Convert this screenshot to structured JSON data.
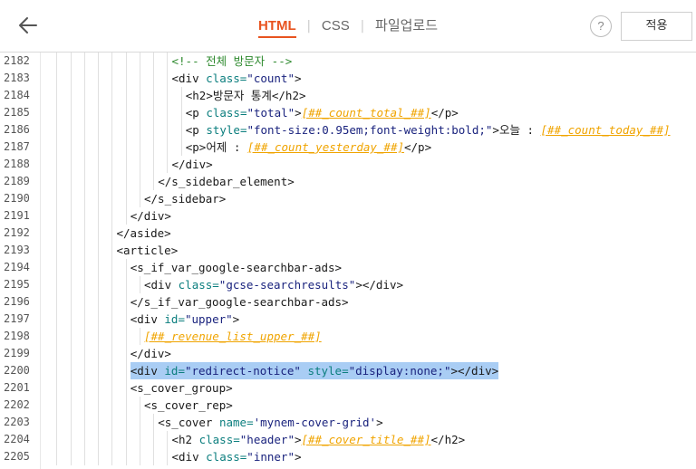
{
  "header": {
    "tabs": [
      "HTML",
      "CSS",
      "파일업로드"
    ],
    "help_label": "?",
    "apply_label": "적용"
  },
  "editor": {
    "lines": [
      {
        "n": "2182",
        "indent": 10,
        "parts": [
          [
            "cmt",
            "<!-- 전체 방문자 -->"
          ]
        ]
      },
      {
        "n": "2183",
        "indent": 10,
        "parts": [
          [
            "tag",
            "<div "
          ],
          [
            "attr",
            "class="
          ],
          [
            "str",
            "\"count\""
          ],
          [
            "tag",
            ">"
          ]
        ]
      },
      {
        "n": "2184",
        "indent": 11,
        "parts": [
          [
            "tag",
            "<h2>방문자 통계</h2>"
          ]
        ]
      },
      {
        "n": "2185",
        "indent": 11,
        "parts": [
          [
            "tag",
            "<p "
          ],
          [
            "attr",
            "class="
          ],
          [
            "str",
            "\"total\""
          ],
          [
            "tag",
            ">"
          ],
          [
            "var",
            "[##_count_total_##]"
          ],
          [
            "tag",
            "</p>"
          ]
        ]
      },
      {
        "n": "2186",
        "indent": 11,
        "parts": [
          [
            "tag",
            "<p "
          ],
          [
            "attr",
            "style="
          ],
          [
            "str",
            "\"font-size:0.95em;font-weight:bold;\""
          ],
          [
            "tag",
            ">오늘 : "
          ],
          [
            "var",
            "[##_count_today_##]"
          ]
        ]
      },
      {
        "n": "2187",
        "indent": 11,
        "parts": [
          [
            "tag",
            "<p>어제 : "
          ],
          [
            "var",
            "[##_count_yesterday_##]"
          ],
          [
            "tag",
            "</p>"
          ]
        ]
      },
      {
        "n": "2188",
        "indent": 10,
        "parts": [
          [
            "tag",
            "</div>"
          ]
        ]
      },
      {
        "n": "2189",
        "indent": 9,
        "parts": [
          [
            "tag",
            "</s_sidebar_element>"
          ]
        ]
      },
      {
        "n": "2190",
        "indent": 8,
        "parts": [
          [
            "tag",
            "</s_sidebar>"
          ]
        ]
      },
      {
        "n": "2191",
        "indent": 7,
        "parts": [
          [
            "tag",
            "</div>"
          ]
        ]
      },
      {
        "n": "2192",
        "indent": 6,
        "parts": [
          [
            "tag",
            "</aside>"
          ]
        ]
      },
      {
        "n": "2193",
        "indent": 6,
        "parts": [
          [
            "tag",
            "<article>"
          ]
        ]
      },
      {
        "n": "2194",
        "indent": 7,
        "parts": [
          [
            "tag",
            "<s_if_var_google-searchbar-ads>"
          ]
        ]
      },
      {
        "n": "2195",
        "indent": 8,
        "parts": [
          [
            "tag",
            "<div "
          ],
          [
            "attr",
            "class="
          ],
          [
            "str",
            "\"gcse-searchresults\""
          ],
          [
            "tag",
            "></div>"
          ]
        ]
      },
      {
        "n": "2196",
        "indent": 7,
        "parts": [
          [
            "tag",
            "</s_if_var_google-searchbar-ads>"
          ]
        ]
      },
      {
        "n": "2197",
        "indent": 7,
        "parts": [
          [
            "tag",
            "<div "
          ],
          [
            "attr",
            "id="
          ],
          [
            "str",
            "\"upper\""
          ],
          [
            "tag",
            ">"
          ]
        ]
      },
      {
        "n": "2198",
        "indent": 8,
        "parts": [
          [
            "var",
            "[##_revenue_list_upper_##]"
          ]
        ]
      },
      {
        "n": "2199",
        "indent": 7,
        "parts": [
          [
            "tag",
            "</div>"
          ]
        ]
      },
      {
        "n": "2200",
        "indent": 7,
        "hl": true,
        "parts": [
          [
            "tag",
            "<div "
          ],
          [
            "attr",
            "id="
          ],
          [
            "str",
            "\"redirect-notice\" "
          ],
          [
            "attr",
            "style="
          ],
          [
            "str",
            "\"display:none;\""
          ],
          [
            "tag",
            "></div>"
          ]
        ]
      },
      {
        "n": "2201",
        "indent": 7,
        "parts": [
          [
            "tag",
            "<s_cover_group>"
          ]
        ]
      },
      {
        "n": "2202",
        "indent": 8,
        "parts": [
          [
            "tag",
            "<s_cover_rep>"
          ]
        ]
      },
      {
        "n": "2203",
        "indent": 9,
        "parts": [
          [
            "tag",
            "<s_cover "
          ],
          [
            "attr",
            "name="
          ],
          [
            "str",
            "'mynem-cover-grid'"
          ],
          [
            "tag",
            ">"
          ]
        ]
      },
      {
        "n": "2204",
        "indent": 10,
        "parts": [
          [
            "tag",
            "<h2 "
          ],
          [
            "attr",
            "class="
          ],
          [
            "str",
            "\"header\""
          ],
          [
            "tag",
            ">"
          ],
          [
            "var",
            "[##_cover_title_##]"
          ],
          [
            "tag",
            "</h2>"
          ]
        ]
      },
      {
        "n": "2205",
        "indent": 10,
        "parts": [
          [
            "tag",
            "<div "
          ],
          [
            "attr",
            "class="
          ],
          [
            "str",
            "\"inner\""
          ],
          [
            "tag",
            ">"
          ]
        ]
      }
    ]
  }
}
